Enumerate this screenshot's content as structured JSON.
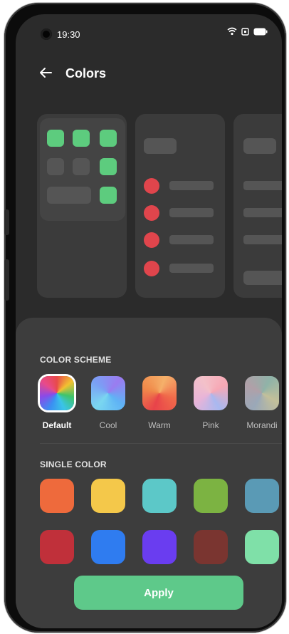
{
  "status_bar": {
    "time": "19:30",
    "icons": [
      "wifi-icon",
      "sim-icon",
      "battery-icon"
    ]
  },
  "header": {
    "back_icon": "arrow-left-icon",
    "title": "Colors"
  },
  "preview": {
    "accent_green": "#5dcc7e",
    "accent_red": "#e0454c"
  },
  "color_scheme": {
    "label": "COLOR SCHEME",
    "selected": "Default",
    "items": [
      {
        "name": "Default",
        "colors": [
          "#e84a4a",
          "#f2c230",
          "#3fc46a",
          "#3a8ff2",
          "#8a4ae8"
        ]
      },
      {
        "name": "Cool",
        "colors": [
          "#9a7cf0",
          "#5fb3f5",
          "#7ad7f0"
        ]
      },
      {
        "name": "Warm",
        "colors": [
          "#f5a05a",
          "#f06a4a",
          "#e8434a"
        ]
      },
      {
        "name": "Pink",
        "colors": [
          "#f7a8b5",
          "#a8b8f0",
          "#f3c1c9"
        ]
      },
      {
        "name": "Morandi",
        "colors": [
          "#8fb3a8",
          "#c3c09a",
          "#9aa8b8"
        ]
      }
    ]
  },
  "single_color": {
    "label": "SINGLE COLOR",
    "rows": [
      [
        "#ee6a3c",
        "#f4c84a",
        "#5cc8c8",
        "#7cb342",
        "#5a9ab5"
      ],
      [
        "#c0303a",
        "#2f7cf0",
        "#6a3df0",
        "#7a3530",
        "#7fe0a8"
      ]
    ]
  },
  "apply_button": {
    "label": "Apply",
    "color": "#5ec98a"
  }
}
